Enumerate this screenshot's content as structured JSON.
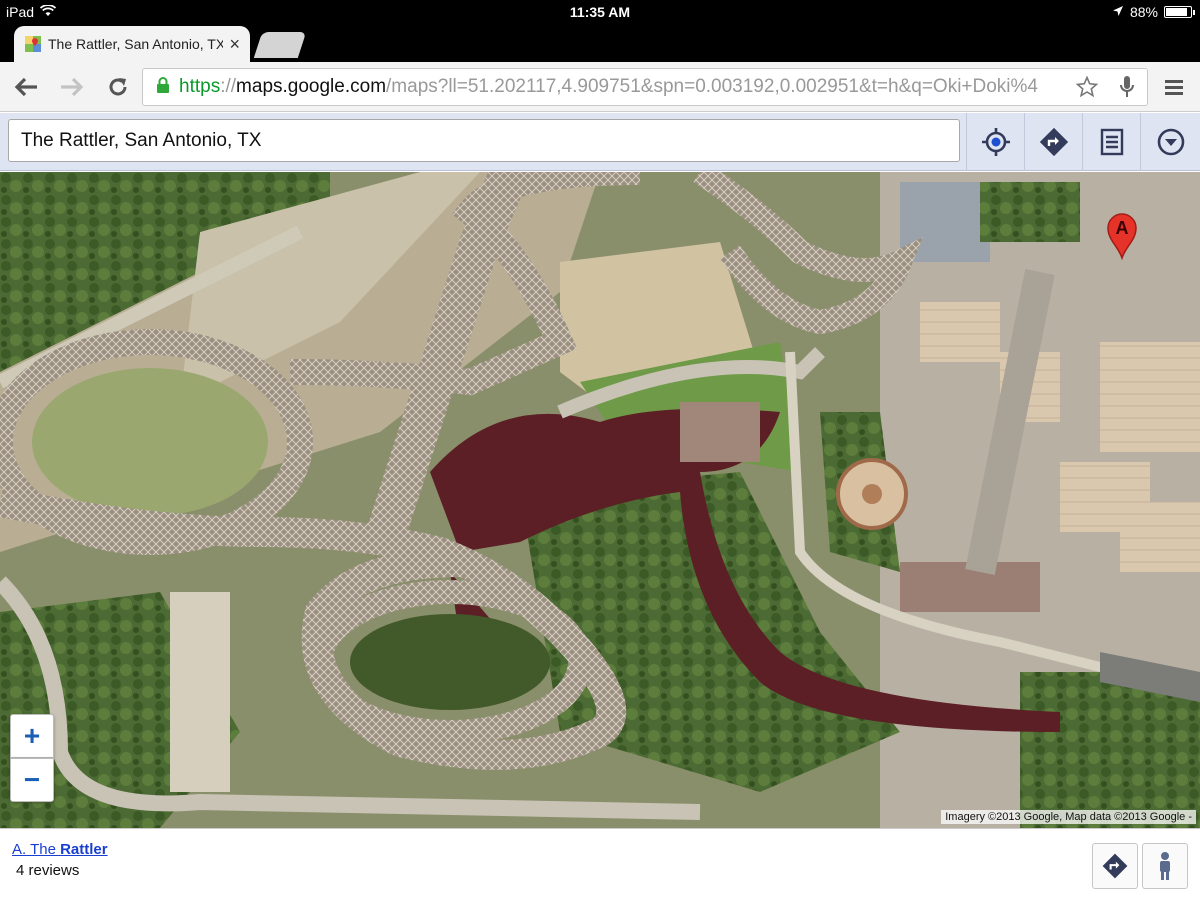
{
  "status": {
    "device": "iPad",
    "time": "11:35 AM",
    "battery_text": "88%",
    "battery_level": 0.88
  },
  "tab": {
    "title": "The Rattler, San Antonio, TX",
    "close": "×"
  },
  "toolbar": {
    "url_scheme": "https",
    "url_sep": "://",
    "url_host": "maps.google.com",
    "url_rest": "/maps?ll=51.202117,4.909751&spn=0.003192,0.002951&t=h&q=Oki+Doki%4"
  },
  "maps": {
    "search_value": "The Rattler, San Antonio, TX",
    "marker_letter": "A",
    "zoom_in": "+",
    "zoom_out": "−",
    "attribution": "Imagery ©2013 Google, Map data ©2013 Google -"
  },
  "result": {
    "prefix": "A. The ",
    "name": "Rattler",
    "reviews": "4 reviews"
  },
  "icons": [
    "wifi-icon",
    "location-arrow-icon",
    "back-icon",
    "forward-icon",
    "reload-icon",
    "lock-icon",
    "star-icon",
    "mic-icon",
    "menu-icon",
    "my-location-icon",
    "directions-icon",
    "list-icon",
    "dropdown-icon",
    "street-view-icon"
  ]
}
